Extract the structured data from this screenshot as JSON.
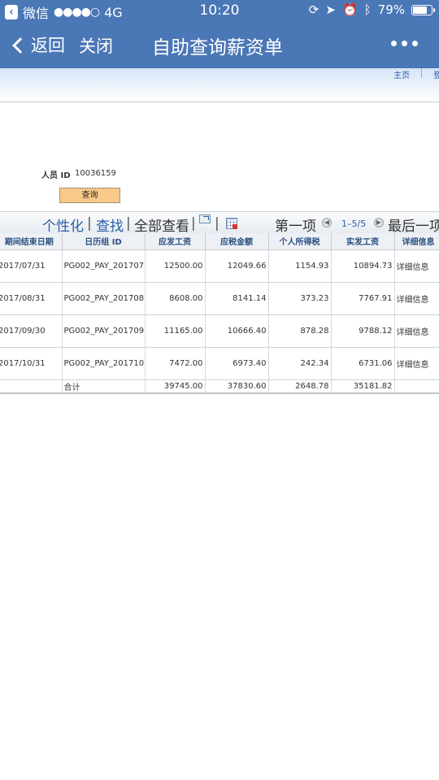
{
  "status_bar": {
    "carrier": "微信",
    "signal": "●●●●○",
    "network": "4G",
    "time": "10:20",
    "battery": "79%",
    "battery_level": 0.79
  },
  "nav": {
    "back_label": "返回",
    "close_label": "关闭",
    "title": "自助查询薪资单"
  },
  "banner": {
    "home_link": "主页",
    "logout_link": "登"
  },
  "form": {
    "person_id_label": "人员 ID",
    "person_id_value": "10036159",
    "query_button": "查询"
  },
  "toolbar": {
    "personalize": "个性化",
    "find": "查找",
    "view_all": "全部查看",
    "first": "第一项",
    "range": "1–5/5",
    "last": "最后一项"
  },
  "table": {
    "columns": [
      "期间结束日期",
      "日历组 ID",
      "应发工资",
      "应税金额",
      "个人所得税",
      "实发工资",
      "详细信息"
    ],
    "rows": [
      [
        "2017/07/31",
        "PG002_PAY_201707",
        "12500.00",
        "12049.66",
        "1154.93",
        "10894.73",
        "详细信息"
      ],
      [
        "2017/08/31",
        "PG002_PAY_201708",
        "8608.00",
        "8141.14",
        "373.23",
        "7767.91",
        "详细信息"
      ],
      [
        "2017/09/30",
        "PG002_PAY_201709",
        "11165.00",
        "10666.40",
        "878.28",
        "9788.12",
        "详细信息"
      ],
      [
        "2017/10/31",
        "PG002_PAY_201710",
        "7472.00",
        "6973.40",
        "242.34",
        "6731.06",
        "详细信息"
      ]
    ],
    "total": [
      "",
      "合计",
      "39745.00",
      "37830.60",
      "2648.78",
      "35181.82",
      ""
    ]
  }
}
